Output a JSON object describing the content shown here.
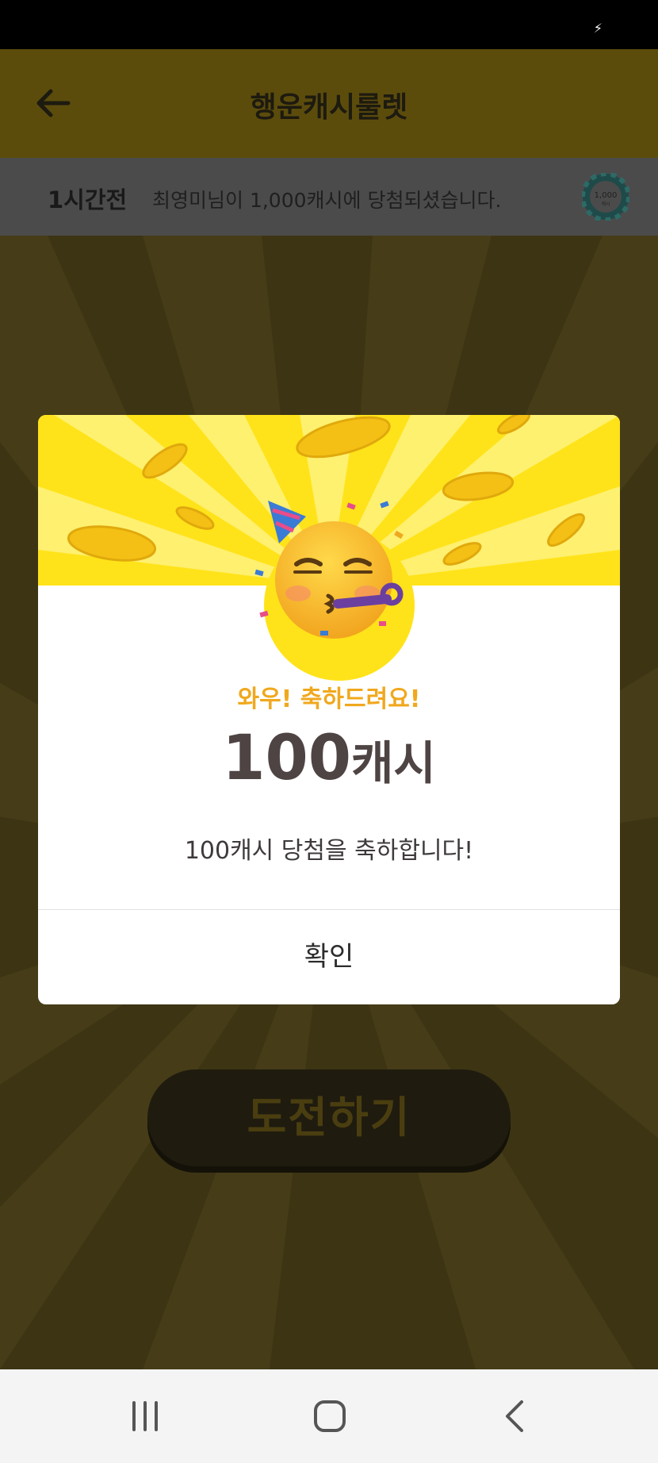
{
  "app_bar": {
    "title": "행운캐시룰렛"
  },
  "ticker": {
    "time": "1시간전",
    "message": "최영미님이 1,000캐시에 당첨되셨습니다.",
    "chip_label": "1,000",
    "chip_sub": "캐시"
  },
  "main": {
    "challenge_label": "도전하기"
  },
  "modal": {
    "wow": "와우! 축하드려요!",
    "amount_number": "100",
    "amount_unit": "캐시",
    "description": "100캐시 당첨을 축하합니다!",
    "confirm_label": "확인"
  },
  "colors": {
    "accent_yellow": "#ffe31a",
    "wow_orange": "#f0a81e",
    "amount_text": "#4f4444"
  },
  "icons": {
    "back": "arrow-left-icon",
    "status": "charging-bolt-icon",
    "recent": "recent-apps-icon",
    "home": "home-icon",
    "nav_back": "nav-back-icon"
  }
}
